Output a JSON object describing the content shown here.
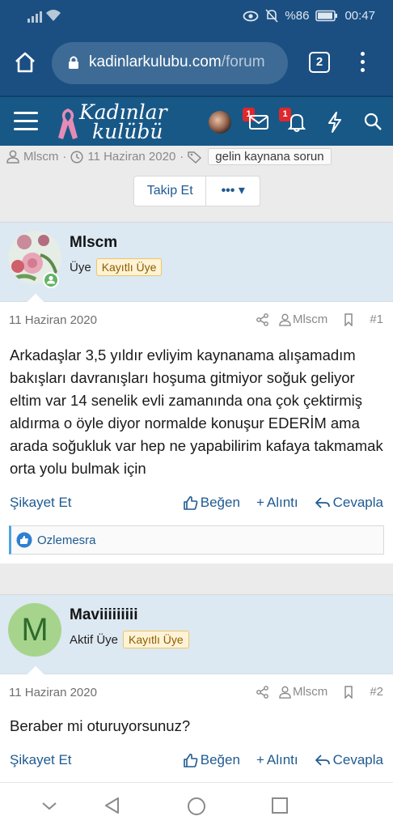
{
  "status_bar": {
    "battery": "%86",
    "time": "00:47"
  },
  "browser": {
    "url_host": "kadinlarkulubu.com",
    "url_path": "/forum",
    "tab_count": "2"
  },
  "site": {
    "logo_line1": "Kadınlar",
    "logo_line2": "kulübü",
    "inbox_badge": "1",
    "alerts_badge": "1"
  },
  "thread": {
    "author": "Mlscm",
    "date": "11 Haziran 2020",
    "tag": "gelin kaynana sorun",
    "follow_label": "Takip Et",
    "more_label": "•••"
  },
  "posts": [
    {
      "username": "Mlscm",
      "role": "Üye",
      "badge": "Kayıtlı Üye",
      "date": "11 Haziran 2020",
      "author_link": "Mlscm",
      "number": "#1",
      "text": "Arkadaşlar 3,5 yıldır evliyim kaynanama alışamadım bakışları davranışları hoşuma gitmiyor soğuk geliyor eltim var 14 senelik evli zamanında ona çok çektirmiş aldırma o öyle diyor normalde konuşur EDERİM ama arada soğukluk var hep ne yapabilirim kafaya takmamak orta yolu bulmak için",
      "report": "Şikayet Et",
      "like": "Beğen",
      "quote": "Alıntı",
      "reply": "Cevapla",
      "liked_by": "Ozlemesra"
    },
    {
      "username": "Maviiiiiiiii",
      "avatar_letter": "M",
      "role": "Aktif Üye",
      "badge": "Kayıtlı Üye",
      "date": "11 Haziran 2020",
      "author_link": "Mlscm",
      "number": "#2",
      "text": "Beraber mi oturuyorsunuz?",
      "report": "Şikayet Et",
      "like": "Beğen",
      "quote": "Alıntı",
      "reply": "Cevapla"
    }
  ],
  "colors": {
    "brand_blue": "#1b4f82",
    "link": "#1f5a91",
    "user_bg": "#dce8f2",
    "badge_bg": "#fef3d6"
  }
}
